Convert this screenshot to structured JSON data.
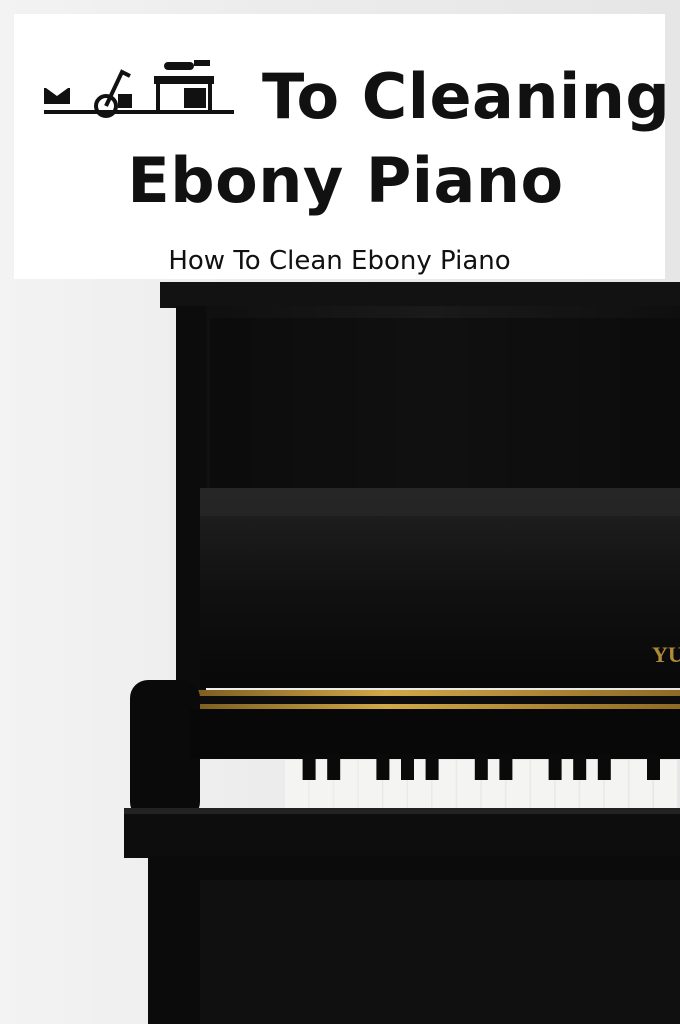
{
  "banner": {
    "title_line1": "To Cleaning",
    "title_line2": "Ebony Piano",
    "subtitle": "How To Clean Ebony Piano"
  },
  "logo": {
    "icon": "cleaning-tools-logo-icon"
  },
  "piano": {
    "brand_partial": "YU"
  },
  "colors": {
    "banner_bg": "#ffffff",
    "piano_black": "#0b0b0b",
    "gold_trim": "#b8902f",
    "wall": "#ececec"
  }
}
